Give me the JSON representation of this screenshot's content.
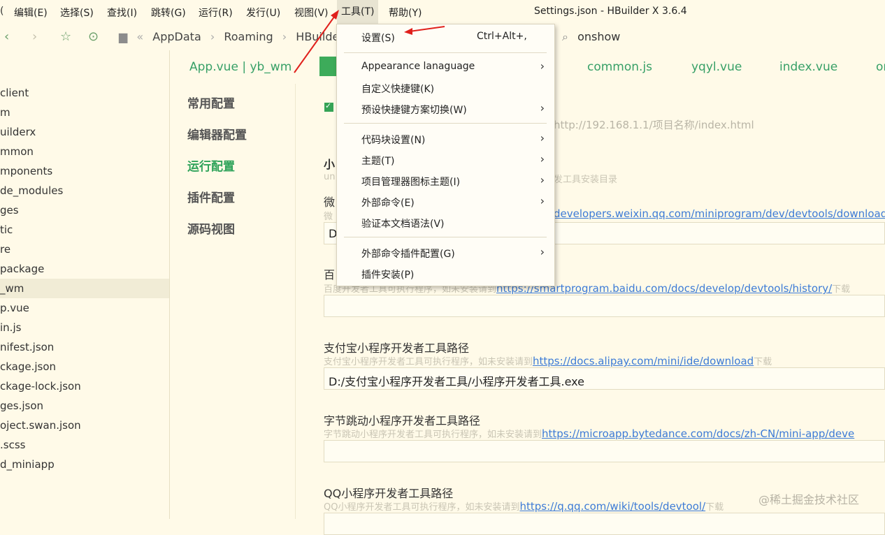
{
  "menubar": {
    "items": [
      "编辑(E)",
      "选择(S)",
      "查找(I)",
      "跳转(G)",
      "运行(R)",
      "发行(U)",
      "视图(V)",
      "工具(T)",
      "帮助(Y)"
    ],
    "window_title": "Settings.json - HBuilder X 3.6.4"
  },
  "toolbar": {
    "breadcrumb": [
      "AppData",
      "Roaming",
      "HBuilder X"
    ],
    "search_value": "onshow"
  },
  "sidebar": {
    "items": [
      "client",
      "m",
      "uilderx",
      "mmon",
      "mponents",
      "de_modules",
      "ges",
      "tic",
      "re",
      "package",
      "_wm",
      "p.vue",
      "in.js",
      "nifest.json",
      "ckage.json",
      "ckage-lock.json",
      "ges.json",
      "oject.swan.json",
      ".scss",
      "d_miniapp"
    ],
    "selected_index": 10
  },
  "tabs": [
    "App.vue | yb_wm",
    "common.js",
    "yqyl.vue",
    "index.vue",
    "on"
  ],
  "settings_nav": {
    "items": [
      "常用配置",
      "编辑器配置",
      "运行配置",
      "插件配置",
      "源码视图"
    ],
    "active_index": 2
  },
  "content": {
    "url_hint": "http://192.168.1.1/项目名称/index.html",
    "partial_title": "小",
    "partial_help_1": "un",
    "partial_help_1_tail": "发工具安装目录",
    "wechat_label": "微",
    "wechat_help_prefix": "微",
    "wechat_link": "developers.weixin.qq.com/miniprogram/dev/devtools/download.",
    "wechat_value": "D",
    "baidu_label": "百",
    "baidu_help": "百度开发者工具可执行程序，如未安装请到",
    "baidu_link": "https://smartprogram.baidu.com/docs/develop/devtools/history/",
    "baidu_suffix": "下载",
    "alipay_label": "支付宝小程序开发者工具路径",
    "alipay_help": "支付宝小程序开发者工具可执行程序，如未安装请到",
    "alipay_link": "https://docs.alipay.com/mini/ide/download",
    "alipay_suffix": "下载",
    "alipay_value": "D:/支付宝小程序开发者工具/小程序开发者工具.exe",
    "bytedance_label": "字节跳动小程序开发者工具路径",
    "bytedance_help": "字节跳动小程序开发者工具可执行程序，如未安装请到",
    "bytedance_link": "https://microapp.bytedance.com/docs/zh-CN/mini-app/deve",
    "qq_label": "QQ小程序开发者工具路径",
    "qq_help": "QQ小程序开发者工具可执行程序，如未安装请到",
    "qq_link": "https://q.qq.com/wiki/tools/devtool/",
    "qq_suffix": "下载"
  },
  "dropdown": {
    "items": [
      {
        "label": "设置(S)",
        "shortcut": "Ctrl+Alt+,",
        "submenu": false
      },
      {
        "label": "Appearance lanaguage",
        "submenu": true
      },
      {
        "label": "自定义快捷键(K)",
        "submenu": false
      },
      {
        "label": "预设快捷键方案切换(W)",
        "submenu": true
      },
      {
        "label": "代码块设置(N)",
        "submenu": true
      },
      {
        "label": "主题(T)",
        "submenu": true
      },
      {
        "label": "项目管理器图标主题(I)",
        "submenu": true
      },
      {
        "label": "外部命令(E)",
        "submenu": true
      },
      {
        "label": "验证本文档语法(V)",
        "submenu": false
      },
      {
        "label": "外部命令插件配置(G)",
        "submenu": true
      },
      {
        "label": "插件安装(P)",
        "submenu": false
      }
    ]
  },
  "watermark": "@稀土掘金技术社区",
  "colors": {
    "accent_green": "#37a067",
    "annotation_red": "#e0201c",
    "link_blue": "#3c7bd6"
  }
}
